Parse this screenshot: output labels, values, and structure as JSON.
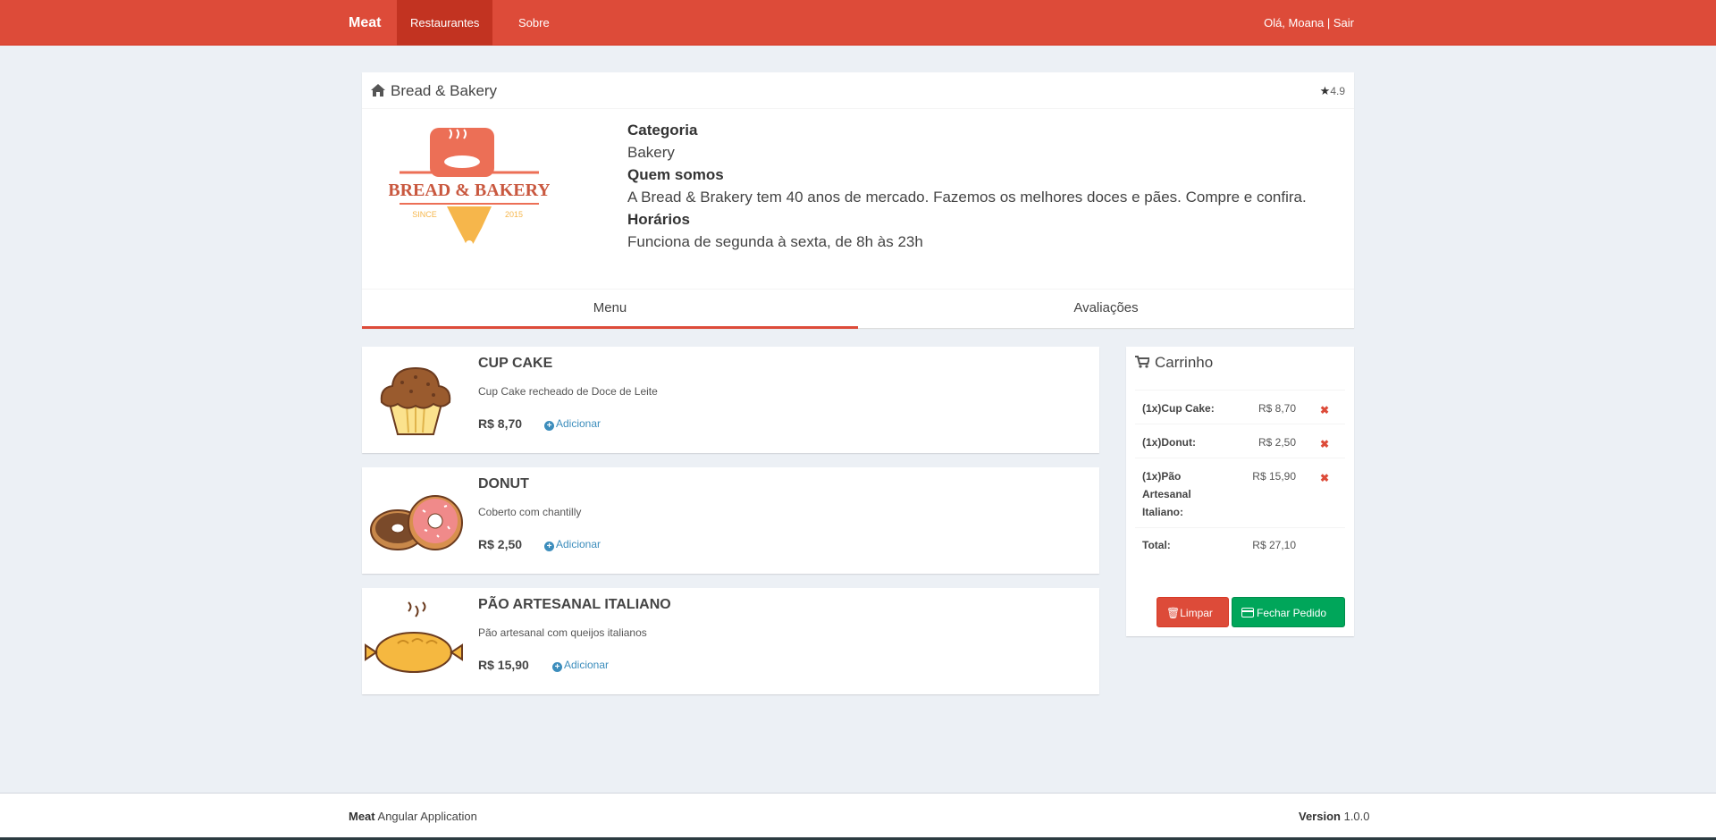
{
  "navbar": {
    "brand": "Meat",
    "links": [
      "Restaurantes",
      "Sobre"
    ],
    "user": "Olá, Moana | Sair",
    "color": "#dd4b39"
  },
  "restaurant": {
    "name": "Bread & Bakery",
    "rating": "4.9",
    "logo_text": "BREAD & BAKERY",
    "logo_since": "SINCE",
    "logo_year": "2015",
    "category_label": "Categoria",
    "category": "Bakery",
    "about_label": "Quem somos",
    "about": "A Bread & Brakery tem 40 anos de mercado. Fazemos os melhores doces e pães. Compre e confira.",
    "hours_label": "Horários",
    "hours": "Funciona de segunda à sexta, de 8h às 23h"
  },
  "tabs": [
    "Menu",
    "Avaliações"
  ],
  "menu": [
    {
      "name": "CUP CAKE",
      "description": "Cup Cake recheado de Doce de Leite",
      "price": "R$ 8,70",
      "add": "Adicionar",
      "icon": "cupcake-icon"
    },
    {
      "name": "DONUT",
      "description": "Coberto com chantilly",
      "price": "R$ 2,50",
      "add": "Adicionar",
      "icon": "donut-icon"
    },
    {
      "name": "PÃO ARTESANAL ITALIANO",
      "description": "Pão artesanal com queijos italianos",
      "price": "R$ 15,90",
      "add": "Adicionar",
      "icon": "bread-icon"
    }
  ],
  "cart": {
    "title": "Carrinho",
    "items": [
      {
        "name": "(1x)Cup Cake:",
        "price": "R$ 8,70"
      },
      {
        "name": "(1x)Donut:",
        "price": "R$ 2,50"
      },
      {
        "name": "(1x)Pão Artesanal Italiano:",
        "price": "R$ 15,90"
      }
    ],
    "total_label": "Total:",
    "total": "R$ 27,10",
    "clear_label": "Limpar",
    "checkout_label": "Fechar Pedido"
  },
  "footer": {
    "brand": "Meat",
    "app": "Angular Application",
    "version_label": "Version",
    "version": "1.0.0"
  }
}
